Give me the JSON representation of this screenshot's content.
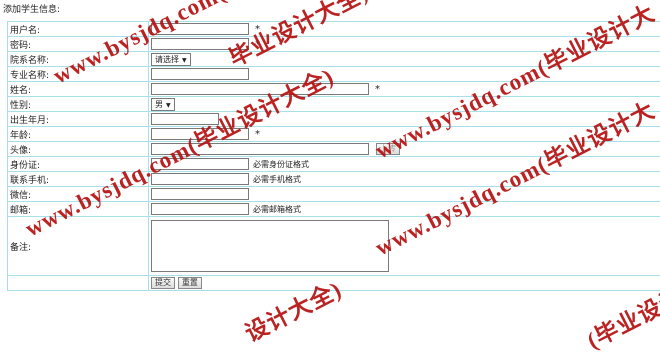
{
  "page_title": "添加学生信息:",
  "form": {
    "rows": [
      {
        "label": "用户名:",
        "required": "*",
        "hint": ""
      },
      {
        "label": "密码:",
        "required": "*",
        "hint": ""
      },
      {
        "label": "院系名称:",
        "select_value": "请选择"
      },
      {
        "label": "专业名称:"
      },
      {
        "label": "姓名:",
        "required": "*"
      },
      {
        "label": "性别:",
        "select_value": "男"
      },
      {
        "label": "出生年月:"
      },
      {
        "label": "年龄:",
        "required": "*"
      },
      {
        "label": "头像:",
        "button": "上传"
      },
      {
        "label": "身份证:",
        "hint": "必需身份证格式"
      },
      {
        "label": "联系手机:",
        "hint": "必需手机格式"
      },
      {
        "label": "微信:"
      },
      {
        "label": "邮箱:",
        "hint": "必需邮箱格式"
      },
      {
        "label": "备注:"
      }
    ],
    "submit_label": "提交",
    "reset_label": "重置"
  },
  "watermark": {
    "text1": "www.bysjdq.com(毕业设计大全)",
    "text2": "www.bysjdq.com(毕业设计大",
    "text3": "www.bysjdq.com(毕业设计大全)",
    "text4": "www.bysjdq.com(毕业设计大",
    "text5": "毕业设计大全)",
    "text6": "设计大全)",
    "text7": "(毕业设计大",
    "color": "#b61010"
  }
}
